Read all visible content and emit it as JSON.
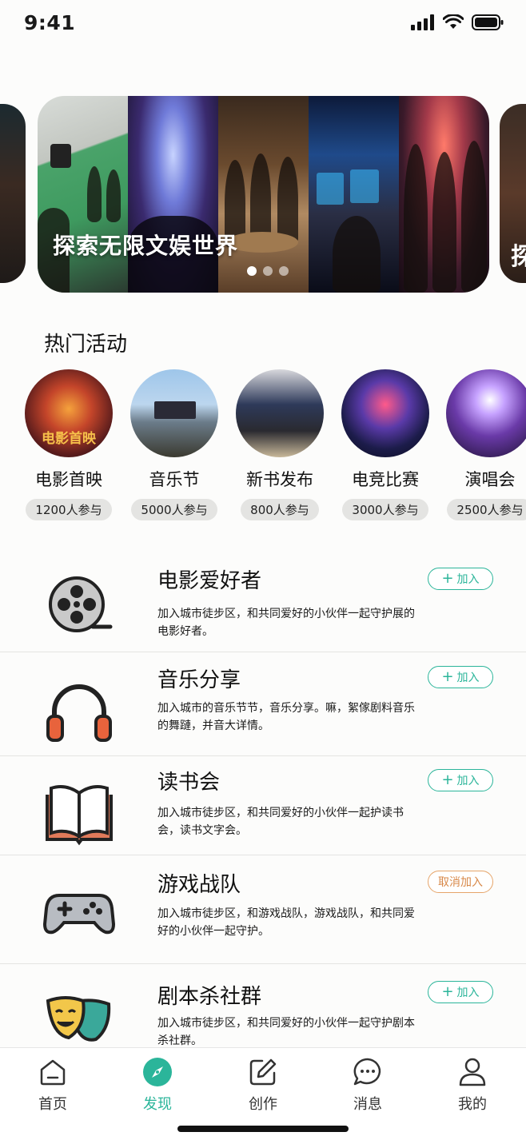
{
  "status_bar": {
    "time": "9:41"
  },
  "banner": {
    "title": "探索无限文娱世界",
    "peek_title": "探",
    "dots": 3,
    "active_dot": 0
  },
  "hot_activities": {
    "title": "热门活动",
    "items": [
      {
        "name": "电影首映",
        "count": "1200人参与",
        "poster_text": "电影首映"
      },
      {
        "name": "音乐节",
        "count": "5000人参与"
      },
      {
        "name": "新书发布",
        "count": "800人参与"
      },
      {
        "name": "电竞比赛",
        "count": "3000人参与"
      },
      {
        "name": "演唱会",
        "count": "2500人参与"
      }
    ]
  },
  "communities": [
    {
      "icon": "film-reel-icon",
      "title": "电影爱好者",
      "desc": "加入城市徒步区，和共同爱好的小伙伴一起守护展的电影好者。",
      "button": "加入",
      "joined": false
    },
    {
      "icon": "headphones-icon",
      "title": "音乐分享",
      "desc": "加入城市的音乐节节，音乐分享。嘛，絮傢剧料音乐的舞蹥，并音大详情。",
      "button": "加入",
      "joined": false
    },
    {
      "icon": "open-book-icon",
      "title": "读书会",
      "desc": "加入城市徒步区，和共同爱好的小伙伴一起护读书会，读书文字会。",
      "button": "加入",
      "joined": false
    },
    {
      "icon": "gamepad-icon",
      "title": "游戏战队",
      "desc": "加入城市徒步区，和游戏战队，游戏战队，和共同爱好的小伙伴一起守护。",
      "button": "取消加入",
      "joined": true
    },
    {
      "icon": "theater-masks-icon",
      "title": "剧本杀社群",
      "desc": "加入城市徒步区，和共同爱好的小伙伴一起守护剧本杀社群。",
      "button": "加入",
      "joined": false
    }
  ],
  "tabbar": {
    "items": [
      {
        "label": "首页",
        "icon": "home-icon"
      },
      {
        "label": "发现",
        "icon": "compass-icon",
        "active": true
      },
      {
        "label": "创作",
        "icon": "edit-icon"
      },
      {
        "label": "消息",
        "icon": "chat-icon"
      },
      {
        "label": "我的",
        "icon": "user-icon"
      }
    ]
  },
  "colors": {
    "accent": "#2bb59a",
    "cancel": "#d8894a"
  }
}
